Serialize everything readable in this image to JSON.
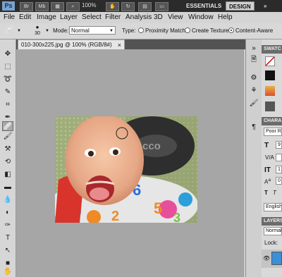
{
  "app": {
    "logo": "Ps",
    "bridge_label": "Br",
    "minibridge_label": "Mb",
    "zoom": "100%",
    "workspaces": [
      "ESSENTIALS",
      "DESIGN"
    ]
  },
  "menu": [
    "File",
    "Edit",
    "Image",
    "Layer",
    "Select",
    "Filter",
    "Analysis",
    "3D",
    "View",
    "Window",
    "Help"
  ],
  "options": {
    "brush_size": "30",
    "mode_label": "Mode:",
    "mode_value": "Normal",
    "type_label": "Type:",
    "type_options": [
      "Proximity Match",
      "Create Texture",
      "Content-Aware"
    ],
    "selected_type": "Content-Aware"
  },
  "document": {
    "tab_title": "010-300x225.jpg @ 100% (RGB/8#)",
    "close_glyph": "×",
    "photo_text": "cco"
  },
  "panels": {
    "swatches_label": "SWATC",
    "character_label": "CHARA",
    "font_family": "Poor Ri",
    "size_value": "9",
    "leading_value": "1",
    "tracking_value": "0",
    "language": "English:",
    "layers_label": "LAYERS",
    "blend_mode": "Normal",
    "lock_label": "Lock:"
  },
  "colors": {
    "accent_active_workspace": "#cfcfcf",
    "appbar_bg": "#2b2b2b",
    "canvas_bg": "#a6a6a6"
  }
}
